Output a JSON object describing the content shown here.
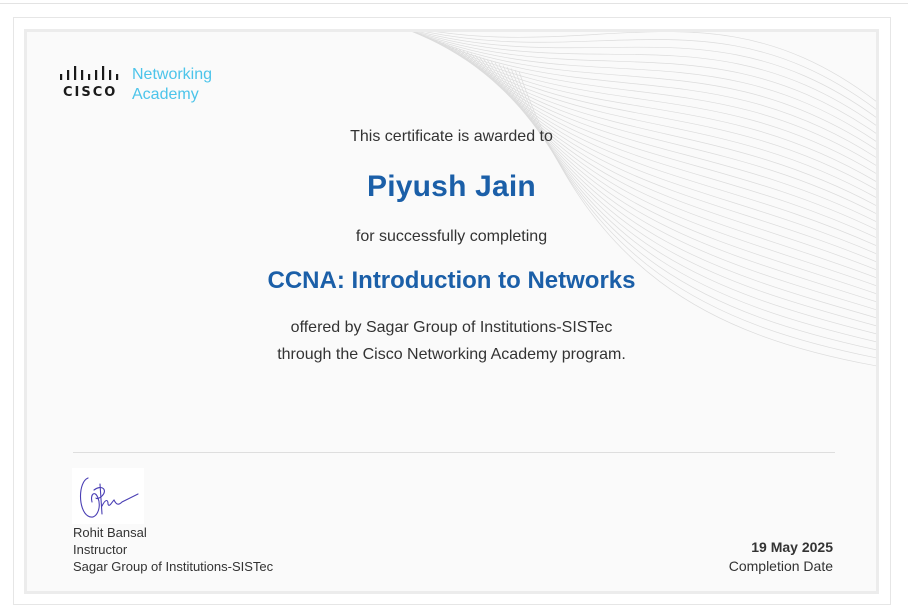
{
  "logo": {
    "brand": "CISCO",
    "product_line1": "Networking",
    "product_line2": "Academy"
  },
  "certificate": {
    "awarded_text": "This certificate is awarded to",
    "recipient": "Piyush Jain",
    "completing_text": "for successfully completing",
    "course": "CCNA: Introduction to Networks",
    "offered_line1": "offered by Sagar Group of Institutions-SISTec",
    "offered_line2": "through the Cisco Networking Academy program."
  },
  "instructor": {
    "name": "Rohit Bansal",
    "role": "Instructor",
    "institution": "Sagar Group of Institutions-SISTec"
  },
  "completion": {
    "date": "19 May 2025",
    "label": "Completion Date"
  },
  "colors": {
    "accent_blue": "#1b5fa8",
    "logo_cyan": "#4cc4ea"
  }
}
